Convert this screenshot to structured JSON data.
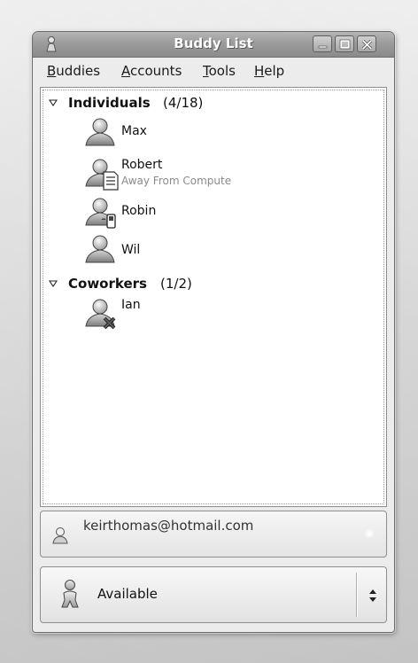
{
  "window": {
    "title": "Buddy List",
    "controls": [
      "minimize-icon",
      "maximize-icon",
      "close-icon"
    ]
  },
  "menu": [
    {
      "mnemonic": "B",
      "rest": "uddies"
    },
    {
      "mnemonic": "A",
      "rest": "ccounts"
    },
    {
      "mnemonic": "T",
      "rest": "ools"
    },
    {
      "mnemonic": "H",
      "rest": "elp"
    }
  ],
  "groups": [
    {
      "name": "Individuals",
      "count": "(4/18)",
      "expanded": true,
      "buddies": [
        {
          "name": "Max",
          "status": "",
          "icon": "person-icon"
        },
        {
          "name": "Robert",
          "status": "Away From Compute",
          "icon": "person-away-icon"
        },
        {
          "name": "Robin",
          "status": "",
          "icon": "person-mobile-icon"
        },
        {
          "name": "Wil",
          "status": "",
          "icon": "person-icon"
        }
      ]
    },
    {
      "name": "Coworkers",
      "count": "(1/2)",
      "expanded": true,
      "buddies": [
        {
          "name": "Ian",
          "status": "",
          "icon": "person-blocked-icon"
        }
      ]
    }
  ],
  "account": {
    "email": "keirthomas@hotmail.com"
  },
  "status": {
    "label": "Available"
  }
}
